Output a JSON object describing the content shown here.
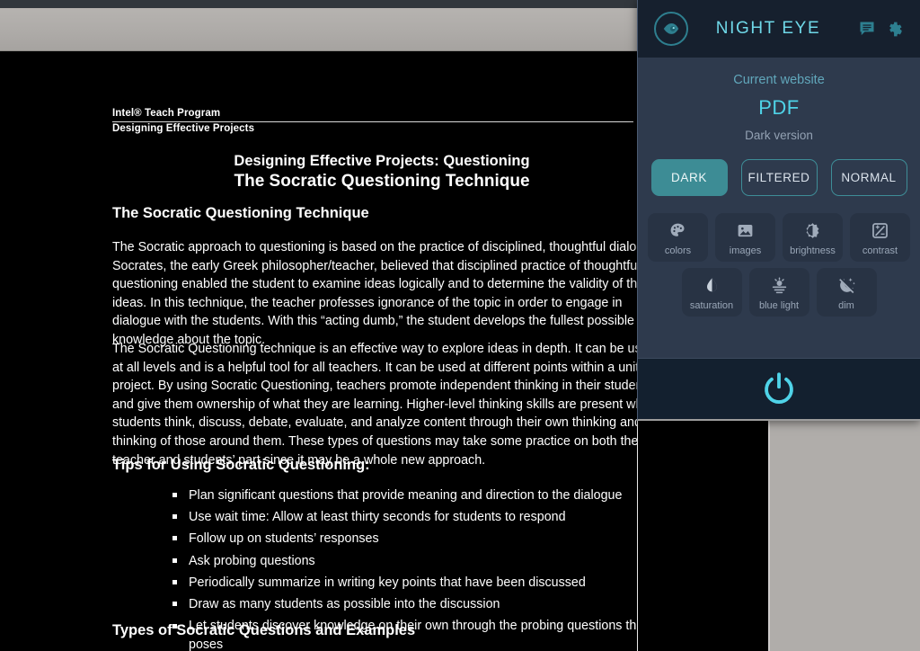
{
  "browser": {
    "pdf_toolbar_color": "#aeaba8",
    "page_background": "#000000",
    "viewer_background": "#b0adaa"
  },
  "document": {
    "header_line_1": "Intel® Teach Program",
    "header_line_2": "Designing Effective Projects",
    "title_line_1": "Designing Effective Projects: Questioning",
    "title_line_2": "The Socratic Questioning Technique",
    "section_1_heading": "The Socratic Questioning Technique",
    "paragraph_1": "The Socratic approach to questioning is based on the practice of disciplined, thoughtful dialogue. Socrates, the early Greek philosopher/teacher, believed that disciplined practice of thoughtful questioning enabled the student to examine ideas logically and to determine the validity of those ideas. In this technique, the teacher professes ignorance of the topic in order to engage in dialogue with the students. With this “acting dumb,” the student develops the fullest possible knowledge about the topic.",
    "paragraph_2": "The Socratic Questioning technique is an effective way to explore ideas in depth. It can be used at all levels and is a helpful tool for all teachers. It can be used at different points within a unit or project. By using Socratic Questioning, teachers promote independent thinking in their students and give them ownership of what they are learning. Higher-level thinking skills are present when students think, discuss, debate, evaluate, and analyze content through their own thinking and the thinking of those around them. These types of questions may take some practice on both the teacher and students’ part since it may be a whole new approach.",
    "section_2_heading": "Tips for Using Socratic Questioning:",
    "tips": [
      "Plan significant questions that provide meaning and direction to the dialogue",
      "Use wait time: Allow at least thirty seconds for students to respond",
      "Follow up on students’ responses",
      "Ask probing questions",
      "Periodically summarize in writing key points that have been discussed",
      "Draw as many students as possible into the discussion",
      "Let students discover knowledge on their own through the probing questions the teacher poses"
    ],
    "section_3_heading": "Types of Socratic Questions and Examples"
  },
  "night_eye": {
    "brand": "NIGHT EYE",
    "logo_icon": "eye-icon",
    "feedback_icon": "message-icon",
    "settings_icon": "gear-icon",
    "accent_color": "#4fd3e8",
    "panel_background": "#2e3a4d",
    "header_background": "#16202e",
    "current_website_label": "Current website",
    "current_website_value": "PDF",
    "version_label": "Dark version",
    "modes": [
      {
        "label": "DARK",
        "state": "active"
      },
      {
        "label": "FILTERED",
        "state": "inactive"
      },
      {
        "label": "NORMAL",
        "state": "inactive"
      }
    ],
    "tiles_row_1": [
      {
        "label": "colors",
        "icon": "palette-icon",
        "disabled": false
      },
      {
        "label": "images",
        "icon": "image-icon",
        "disabled": false
      },
      {
        "label": "brightness",
        "icon": "brightness-icon",
        "disabled": false
      },
      {
        "label": "contrast",
        "icon": "contrast-icon",
        "disabled": false
      }
    ],
    "tiles_row_2": [
      {
        "label": "saturation",
        "icon": "saturation-icon",
        "disabled": false
      },
      {
        "label": "blue light",
        "icon": "blue-light-off-icon",
        "disabled": true
      },
      {
        "label": "dim",
        "icon": "dim-off-icon",
        "disabled": true
      }
    ],
    "power_icon": "power-icon",
    "power_color": "#4fd3e8"
  }
}
